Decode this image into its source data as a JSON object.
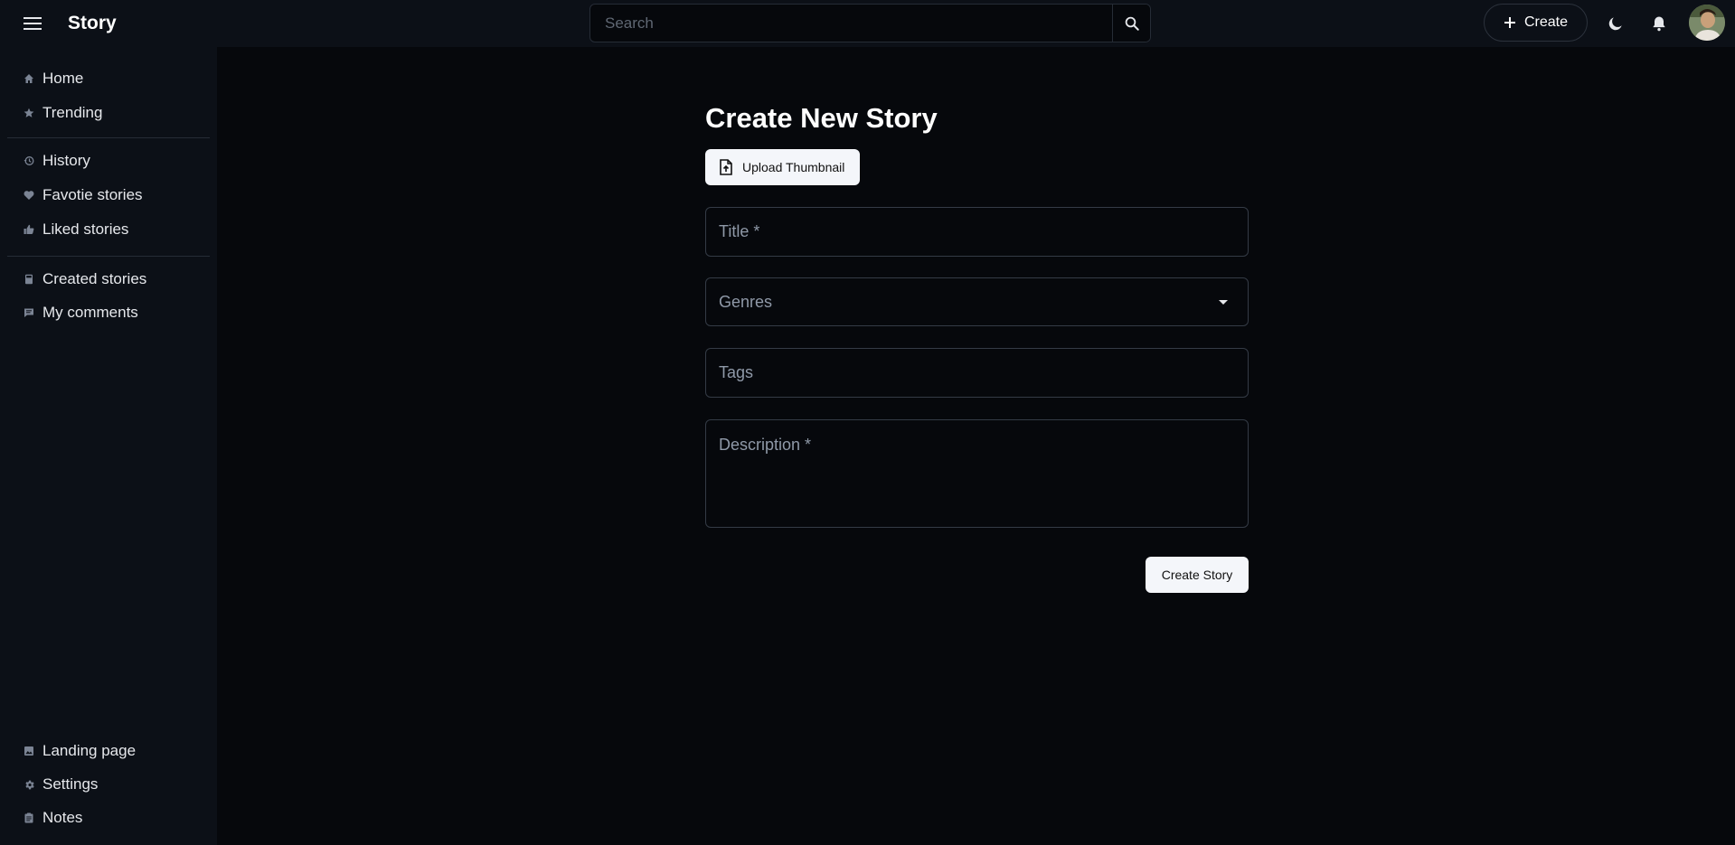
{
  "app": {
    "brand": "Story"
  },
  "header": {
    "search": {
      "placeholder": "Search",
      "value": ""
    },
    "create_label": "Create"
  },
  "sidebar": {
    "groups": [
      [
        {
          "label": "Home",
          "icon": "home-icon"
        },
        {
          "label": "Trending",
          "icon": "star-icon"
        }
      ],
      [
        {
          "label": "History",
          "icon": "history-icon"
        },
        {
          "label": "Favotie stories",
          "icon": "heart-icon"
        },
        {
          "label": "Liked stories",
          "icon": "thumbs-up-icon"
        }
      ],
      [
        {
          "label": "Created stories",
          "icon": "book-icon"
        },
        {
          "label": "My comments",
          "icon": "comment-icon"
        }
      ]
    ],
    "footer": [
      {
        "label": "Landing page",
        "icon": "image-icon"
      },
      {
        "label": "Settings",
        "icon": "gear-icon"
      },
      {
        "label": "Notes",
        "icon": "clipboard-icon"
      }
    ]
  },
  "form": {
    "title": "Create New Story",
    "upload_label": "Upload Thumbnail",
    "title_field": {
      "placeholder": "Title *",
      "value": ""
    },
    "genres_field": {
      "placeholder": "Genres",
      "value": ""
    },
    "tags_field": {
      "placeholder": "Tags",
      "value": ""
    },
    "description_field": {
      "placeholder": "Description *",
      "value": ""
    },
    "submit_label": "Create Story"
  },
  "colors": {
    "background": "#06080c",
    "panel": "#0c1017",
    "border": "#343b46",
    "button_light": "#f4f6fa"
  }
}
